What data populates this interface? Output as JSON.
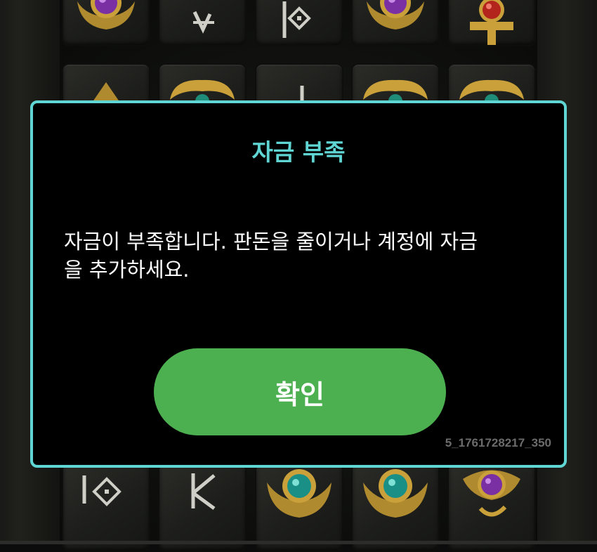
{
  "dialog": {
    "title": "자금 부족",
    "message": "자금이 부족합니다. 판돈을 줄이거나 계정에 자금\n을 추가하세요.",
    "confirm_label": "확인",
    "session_id": "5_1761728217_350"
  },
  "colors": {
    "accent": "#5fd6d3",
    "button": "#4caf50",
    "background": "#000000"
  },
  "board_icons": [
    "purple-gem-scarab-icon",
    "rune-arrow-icon",
    "rune-diamond-icon",
    "purple-gem-scarab-icon",
    "red-gem-ankh-icon",
    "pyramid-icon",
    "gold-ram-icon",
    "rune-staff-icon",
    "gold-ram-icon",
    "gold-ram-icon",
    "rune-diamond-icon",
    "rune-k-icon",
    "teal-gem-scarab-icon",
    "teal-gem-scarab-icon",
    "purple-gem-eye-icon"
  ]
}
